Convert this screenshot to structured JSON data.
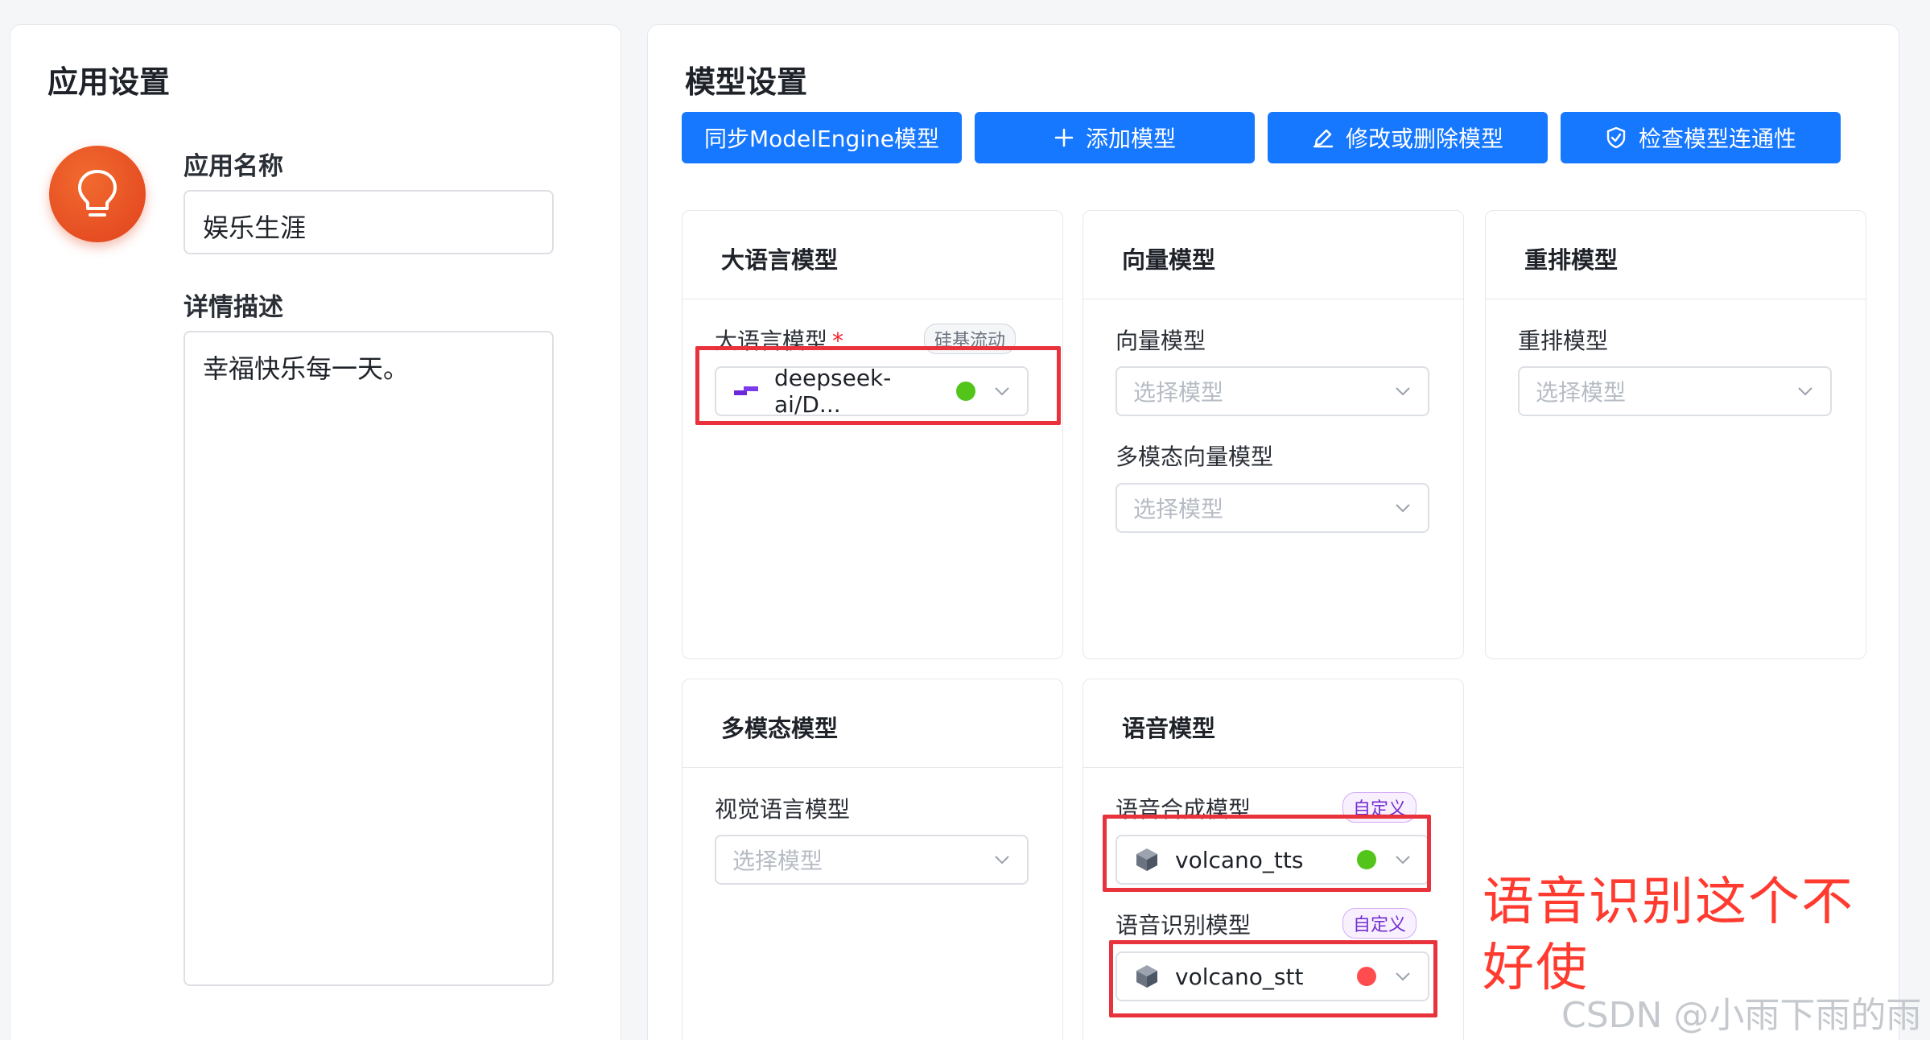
{
  "app_settings": {
    "title": "应用设置",
    "name_label": "应用名称",
    "name_value": "娱乐生涯",
    "desc_label": "详情描述",
    "desc_value": "幸福快乐每一天。",
    "icon": "lightbulb-icon"
  },
  "model_settings": {
    "title": "模型设置",
    "buttons": {
      "sync": "同步ModelEngine模型",
      "add": "添加模型",
      "edit": "修改或删除模型",
      "check": "检查模型连通性"
    },
    "cards": {
      "llm": {
        "title": "大语言模型",
        "field_label": "大语言模型",
        "required_mark": "*",
        "tag": "硅基流动",
        "value": "deepseek-ai/D...",
        "status": "green"
      },
      "embedding": {
        "title": "向量模型",
        "field1_label": "向量模型",
        "field1_placeholder": "选择模型",
        "field2_label": "多模态向量模型",
        "field2_placeholder": "选择模型"
      },
      "rerank": {
        "title": "重排模型",
        "field_label": "重排模型",
        "placeholder": "选择模型"
      },
      "multimodal": {
        "title": "多模态模型",
        "field_label": "视觉语言模型",
        "placeholder": "选择模型"
      },
      "voice": {
        "title": "语音模型",
        "tts_label": "语音合成模型",
        "tts_tag": "自定义",
        "tts_value": "volcano_tts",
        "tts_status": "green",
        "stt_label": "语音识别模型",
        "stt_tag": "自定义",
        "stt_value": "volcano_stt",
        "stt_status": "red"
      }
    }
  },
  "annotation": "语音识别这个不好使",
  "watermark": "CSDN @小雨下雨的雨",
  "colors": {
    "primary": "#1677ff",
    "status_green": "#52c41a",
    "status_red": "#ff4d4f",
    "highlight_red": "#e8323c",
    "app_icon": "#e84a22"
  }
}
